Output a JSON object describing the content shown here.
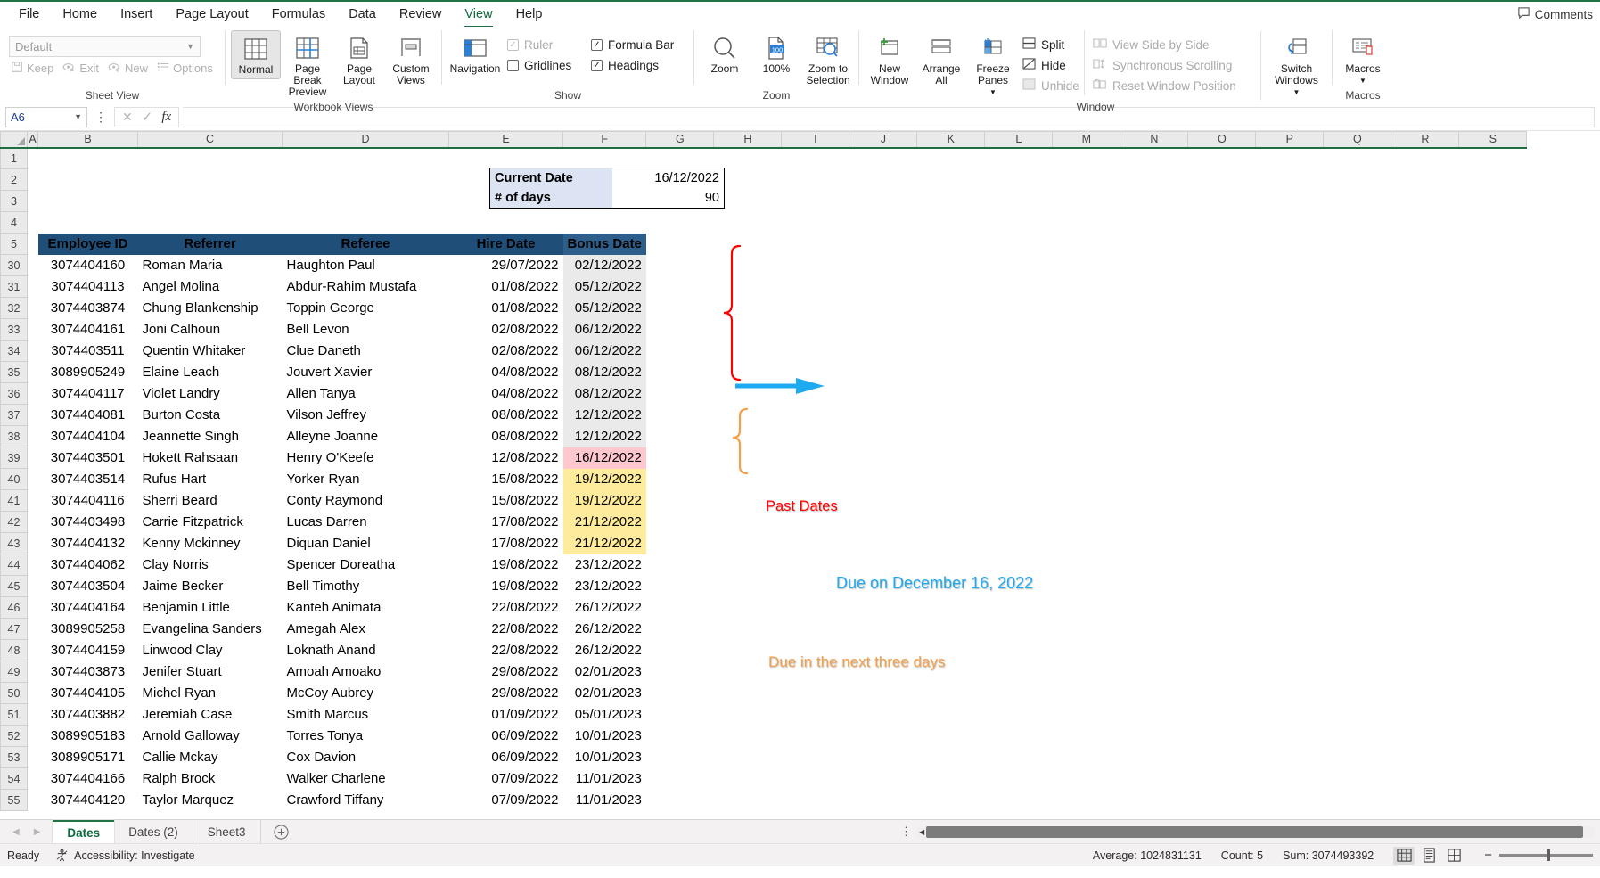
{
  "ribbon": {
    "tabs": [
      {
        "label": "File",
        "active": false
      },
      {
        "label": "Home",
        "active": false
      },
      {
        "label": "Insert",
        "active": false
      },
      {
        "label": "Page Layout",
        "active": false
      },
      {
        "label": "Formulas",
        "active": false
      },
      {
        "label": "Data",
        "active": false
      },
      {
        "label": "Review",
        "active": false
      },
      {
        "label": "View",
        "active": true
      },
      {
        "label": "Help",
        "active": false
      }
    ],
    "comments_label": "Comments",
    "groups": {
      "sheet_view": {
        "label": "Sheet View",
        "select_value": "Default",
        "buttons": [
          "Keep",
          "Exit",
          "New",
          "Options"
        ]
      },
      "workbook_views": {
        "label": "Workbook Views",
        "buttons": [
          "Normal",
          "Page Break Preview",
          "Page Layout",
          "Custom Views"
        ]
      },
      "show": {
        "label": "Show",
        "navigation": "Navigation",
        "checks": [
          {
            "label": "Ruler",
            "checked": true,
            "disabled": true
          },
          {
            "label": "Formula Bar",
            "checked": true,
            "disabled": false
          },
          {
            "label": "Gridlines",
            "checked": false,
            "disabled": false
          },
          {
            "label": "Headings",
            "checked": true,
            "disabled": false
          }
        ]
      },
      "zoom": {
        "label": "Zoom",
        "buttons": [
          "Zoom",
          "100%",
          "Zoom to Selection"
        ],
        "zoom_badge": "100"
      },
      "window": {
        "label": "Window",
        "big_buttons": [
          "New Window",
          "Arrange All",
          "Freeze Panes"
        ],
        "small_buttons": [
          {
            "label": "Split",
            "disabled": false
          },
          {
            "label": "Hide",
            "disabled": false
          },
          {
            "label": "Unhide",
            "disabled": true
          },
          {
            "label": "View Side by Side",
            "disabled": true
          },
          {
            "label": "Synchronous Scrolling",
            "disabled": true
          },
          {
            "label": "Reset Window Position",
            "disabled": true
          }
        ],
        "switch_windows": "Switch Windows"
      },
      "macros": {
        "label": "Macros",
        "button": "Macros"
      }
    }
  },
  "formula_bar": {
    "name_box": "A6",
    "formula_value": ""
  },
  "grid": {
    "column_headers": [
      "A",
      "B",
      "C",
      "D",
      "E",
      "F",
      "G",
      "H",
      "I",
      "J",
      "K",
      "L",
      "M",
      "N",
      "O",
      "P",
      "Q",
      "R",
      "S"
    ],
    "row_numbers": [
      "1",
      "2",
      "3",
      "4",
      "5",
      "30",
      "31",
      "32",
      "33",
      "34",
      "35",
      "36",
      "37",
      "38",
      "39",
      "40",
      "41",
      "42",
      "43",
      "44",
      "45",
      "46",
      "47",
      "48",
      "49",
      "50",
      "51",
      "52",
      "53",
      "54",
      "55"
    ]
  },
  "info_box": {
    "rows": [
      {
        "label": "Current Date",
        "value": "16/12/2022"
      },
      {
        "label": "# of days",
        "value": "90"
      }
    ]
  },
  "table": {
    "headers": [
      "Employee ID",
      "Referrer",
      "Referee",
      "Hire Date",
      "Bonus Date"
    ],
    "rows": [
      {
        "row": "30",
        "id": "3074404160",
        "referrer": "Roman Maria",
        "referee": "Haughton Paul",
        "hire": "29/07/2022",
        "bonus": "02/12/2022",
        "state": "past"
      },
      {
        "row": "31",
        "id": "3074404113",
        "referrer": "Angel Molina",
        "referee": "Abdur-Rahim Mustafa",
        "hire": "01/08/2022",
        "bonus": "05/12/2022",
        "state": "past"
      },
      {
        "row": "32",
        "id": "3074403874",
        "referrer": "Chung Blankenship",
        "referee": "Toppin George",
        "hire": "01/08/2022",
        "bonus": "05/12/2022",
        "state": "past"
      },
      {
        "row": "33",
        "id": "3074404161",
        "referrer": "Joni Calhoun",
        "referee": "Bell Levon",
        "hire": "02/08/2022",
        "bonus": "06/12/2022",
        "state": "past"
      },
      {
        "row": "34",
        "id": "3074403511",
        "referrer": "Quentin Whitaker",
        "referee": "Clue Daneth",
        "hire": "02/08/2022",
        "bonus": "06/12/2022",
        "state": "past"
      },
      {
        "row": "35",
        "id": "3089905249",
        "referrer": "Elaine Leach",
        "referee": "Jouvert Xavier",
        "hire": "04/08/2022",
        "bonus": "08/12/2022",
        "state": "past"
      },
      {
        "row": "36",
        "id": "3074404117",
        "referrer": "Violet Landry",
        "referee": "Allen Tanya",
        "hire": "04/08/2022",
        "bonus": "08/12/2022",
        "state": "past"
      },
      {
        "row": "37",
        "id": "3074404081",
        "referrer": "Burton Costa",
        "referee": "Vilson Jeffrey",
        "hire": "08/08/2022",
        "bonus": "12/12/2022",
        "state": "past"
      },
      {
        "row": "38",
        "id": "3074404104",
        "referrer": "Jeannette Singh",
        "referee": "Alleyne Joanne",
        "hire": "08/08/2022",
        "bonus": "12/12/2022",
        "state": "past"
      },
      {
        "row": "39",
        "id": "3074403501",
        "referrer": "Hokett Rahsaan",
        "referee": "Henry O'Keefe",
        "hire": "12/08/2022",
        "bonus": "16/12/2022",
        "state": "today"
      },
      {
        "row": "40",
        "id": "3074403514",
        "referrer": "Rufus Hart",
        "referee": "Yorker Ryan",
        "hire": "15/08/2022",
        "bonus": "19/12/2022",
        "state": "soon"
      },
      {
        "row": "41",
        "id": "3074404116",
        "referrer": "Sherri Beard",
        "referee": "Conty Raymond",
        "hire": "15/08/2022",
        "bonus": "19/12/2022",
        "state": "soon"
      },
      {
        "row": "42",
        "id": "3074403498",
        "referrer": "Carrie Fitzpatrick",
        "referee": "Lucas Darren",
        "hire": "17/08/2022",
        "bonus": "21/12/2022",
        "state": "soon"
      },
      {
        "row": "43",
        "id": "3074404132",
        "referrer": "Kenny Mckinney",
        "referee": "Diquan Daniel",
        "hire": "17/08/2022",
        "bonus": "21/12/2022",
        "state": "soon"
      },
      {
        "row": "44",
        "id": "3074404062",
        "referrer": "Clay Norris",
        "referee": "Spencer Doreatha",
        "hire": "19/08/2022",
        "bonus": "23/12/2022",
        "state": "none"
      },
      {
        "row": "45",
        "id": "3074403504",
        "referrer": "Jaime Becker",
        "referee": "Bell Timothy",
        "hire": "19/08/2022",
        "bonus": "23/12/2022",
        "state": "none"
      },
      {
        "row": "46",
        "id": "3074404164",
        "referrer": "Benjamin Little",
        "referee": "Kanteh Animata",
        "hire": "22/08/2022",
        "bonus": "26/12/2022",
        "state": "none"
      },
      {
        "row": "47",
        "id": "3089905258",
        "referrer": "Evangelina Sanders",
        "referee": "Amegah Alex",
        "hire": "22/08/2022",
        "bonus": "26/12/2022",
        "state": "none"
      },
      {
        "row": "48",
        "id": "3074404159",
        "referrer": "Linwood Clay",
        "referee": "Loknath Anand",
        "hire": "22/08/2022",
        "bonus": "26/12/2022",
        "state": "none"
      },
      {
        "row": "49",
        "id": "3074403873",
        "referrer": "Jenifer Stuart",
        "referee": "Amoah Amoako",
        "hire": "29/08/2022",
        "bonus": "02/01/2023",
        "state": "none"
      },
      {
        "row": "50",
        "id": "3074404105",
        "referrer": "Michel Ryan",
        "referee": "McCoy Aubrey",
        "hire": "29/08/2022",
        "bonus": "02/01/2023",
        "state": "none"
      },
      {
        "row": "51",
        "id": "3074403882",
        "referrer": "Jeremiah Case",
        "referee": "Smith Marcus",
        "hire": "01/09/2022",
        "bonus": "05/01/2023",
        "state": "none"
      },
      {
        "row": "52",
        "id": "3089905183",
        "referrer": "Arnold Galloway",
        "referee": "Torres Tonya",
        "hire": "06/09/2022",
        "bonus": "10/01/2023",
        "state": "none"
      },
      {
        "row": "53",
        "id": "3089905171",
        "referrer": "Callie Mckay",
        "referee": "Cox Davion",
        "hire": "06/09/2022",
        "bonus": "10/01/2023",
        "state": "none"
      },
      {
        "row": "54",
        "id": "3074404166",
        "referrer": "Ralph Brock",
        "referee": "Walker Charlene",
        "hire": "07/09/2022",
        "bonus": "11/01/2023",
        "state": "none"
      },
      {
        "row": "55",
        "id": "3074404120",
        "referrer": "Taylor Marquez",
        "referee": "Crawford Tiffany",
        "hire": "07/09/2022",
        "bonus": "11/01/2023",
        "state": "none"
      }
    ]
  },
  "annotations": [
    {
      "text": "Past Dates",
      "color": "#ff0000"
    },
    {
      "text": "Due on December 16, 2022",
      "color": "#1eaaf1"
    },
    {
      "text": "Due in the next three days",
      "color": "#f5a04a"
    }
  ],
  "sheet_tabs": {
    "items": [
      {
        "label": "Dates",
        "active": true
      },
      {
        "label": "Dates (2)",
        "active": false
      },
      {
        "label": "Sheet3",
        "active": false
      }
    ]
  },
  "status_bar": {
    "ready": "Ready",
    "accessibility": "Accessibility: Investigate",
    "average": "Average: 1024831131",
    "count": "Count: 5",
    "sum": "Sum: 3074493392"
  }
}
